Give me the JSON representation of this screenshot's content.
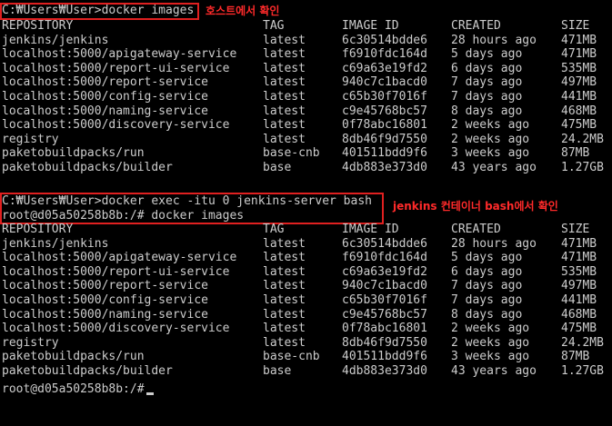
{
  "colors": {
    "background": "#000000",
    "text": "#cccccc",
    "highlight_box": "#e02020",
    "annotation": "#ff2a2a"
  },
  "section1": {
    "command": "C:₩Users₩User>docker images",
    "annotation": "호스트에서 확인",
    "header": {
      "repository": "REPOSITORY",
      "tag": "TAG",
      "image_id": "IMAGE ID",
      "created": "CREATED",
      "size": "SIZE"
    },
    "rows": [
      {
        "repository": "jenkins/jenkins",
        "tag": "latest",
        "image_id": "6c30514bdde6",
        "created": "28 hours ago",
        "size": "471MB"
      },
      {
        "repository": "localhost:5000/apigateway-service",
        "tag": "latest",
        "image_id": "f6910fdc164d",
        "created": "5 days ago",
        "size": "471MB"
      },
      {
        "repository": "localhost:5000/report-ui-service",
        "tag": "latest",
        "image_id": "c69a63e19fd2",
        "created": "6 days ago",
        "size": "535MB"
      },
      {
        "repository": "localhost:5000/report-service",
        "tag": "latest",
        "image_id": "940c7c1bacd0",
        "created": "7 days ago",
        "size": "497MB"
      },
      {
        "repository": "localhost:5000/config-service",
        "tag": "latest",
        "image_id": "c65b30f7016f",
        "created": "7 days ago",
        "size": "441MB"
      },
      {
        "repository": "localhost:5000/naming-service",
        "tag": "latest",
        "image_id": "c9e45768bc57",
        "created": "8 days ago",
        "size": "468MB"
      },
      {
        "repository": "localhost:5000/discovery-service",
        "tag": "latest",
        "image_id": "0f78abc16801",
        "created": "2 weeks ago",
        "size": "475MB"
      },
      {
        "repository": "registry",
        "tag": "latest",
        "image_id": "8db46f9d7550",
        "created": "2 weeks ago",
        "size": "24.2MB"
      },
      {
        "repository": "paketobuildpacks/run",
        "tag": "base-cnb",
        "image_id": "401511bdd9f6",
        "created": "3 weeks ago",
        "size": "87MB"
      },
      {
        "repository": "paketobuildpacks/builder",
        "tag": "base",
        "image_id": "4db883e373d0",
        "created": "43 years ago",
        "size": "1.27GB"
      }
    ]
  },
  "section2": {
    "command_line1": "C:₩Users₩User>docker exec -itu 0 jenkins-server bash",
    "command_line2": "root@d05a50258b8b:/# docker images",
    "annotation": "jenkins 컨테이너 bash에서 확인",
    "header": {
      "repository": "REPOSITORY",
      "tag": "TAG",
      "image_id": "IMAGE ID",
      "created": "CREATED",
      "size": "SIZE"
    },
    "rows": [
      {
        "repository": "jenkins/jenkins",
        "tag": "latest",
        "image_id": "6c30514bdde6",
        "created": "28 hours ago",
        "size": "471MB"
      },
      {
        "repository": "localhost:5000/apigateway-service",
        "tag": "latest",
        "image_id": "f6910fdc164d",
        "created": "5 days ago",
        "size": "471MB"
      },
      {
        "repository": "localhost:5000/report-ui-service",
        "tag": "latest",
        "image_id": "c69a63e19fd2",
        "created": "6 days ago",
        "size": "535MB"
      },
      {
        "repository": "localhost:5000/report-service",
        "tag": "latest",
        "image_id": "940c7c1bacd0",
        "created": "7 days ago",
        "size": "497MB"
      },
      {
        "repository": "localhost:5000/config-service",
        "tag": "latest",
        "image_id": "c65b30f7016f",
        "created": "7 days ago",
        "size": "441MB"
      },
      {
        "repository": "localhost:5000/naming-service",
        "tag": "latest",
        "image_id": "c9e45768bc57",
        "created": "8 days ago",
        "size": "468MB"
      },
      {
        "repository": "localhost:5000/discovery-service",
        "tag": "latest",
        "image_id": "0f78abc16801",
        "created": "2 weeks ago",
        "size": "475MB"
      },
      {
        "repository": "registry",
        "tag": "latest",
        "image_id": "8db46f9d7550",
        "created": "2 weeks ago",
        "size": "24.2MB"
      },
      {
        "repository": "paketobuildpacks/run",
        "tag": "base-cnb",
        "image_id": "401511bdd9f6",
        "created": "3 weeks ago",
        "size": "87MB"
      },
      {
        "repository": "paketobuildpacks/builder",
        "tag": "base",
        "image_id": "4db883e373d0",
        "created": "43 years ago",
        "size": "1.27GB"
      }
    ],
    "prompt": "root@d05a50258b8b:/#"
  }
}
